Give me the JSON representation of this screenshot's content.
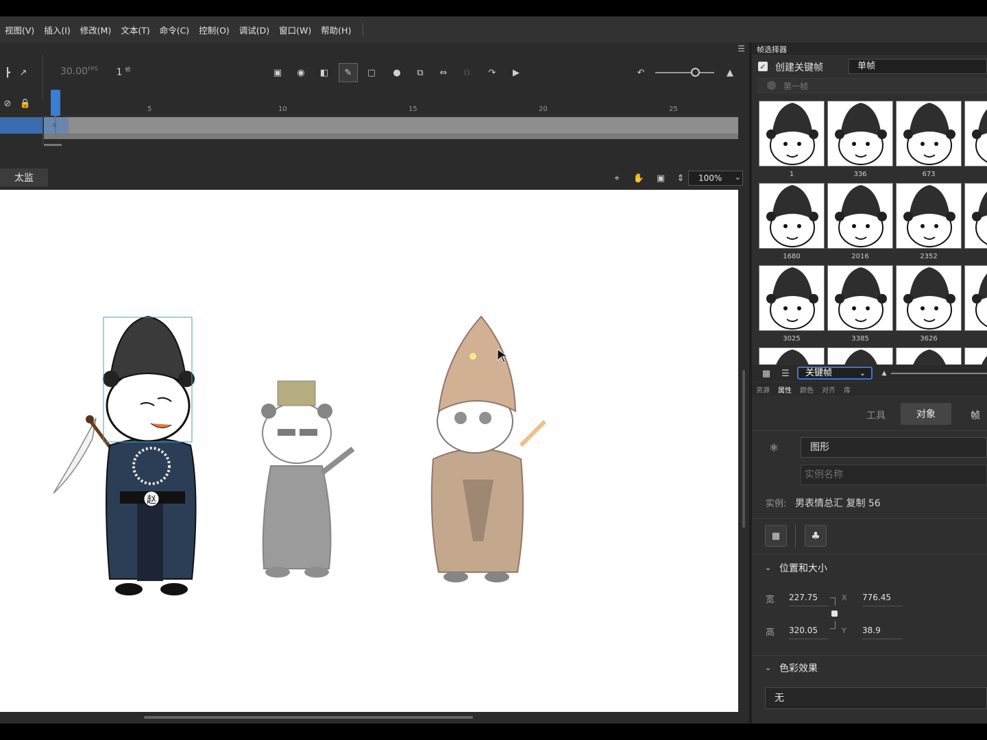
{
  "menu": {
    "items": [
      "视图(V)",
      "插入(I)",
      "修改(M)",
      "文本(T)",
      "命令(C)",
      "控制(O)",
      "调试(D)",
      "窗口(W)",
      "帮助(H)"
    ]
  },
  "timeline": {
    "fps": "30.00",
    "fps_unit": "FPS",
    "frame": "1",
    "frame_unit": "帧",
    "ruler_ticks": [
      "5",
      "10",
      "15",
      "20",
      "25"
    ],
    "keyframe_marker": "o"
  },
  "scene": {
    "tab_label": "太监",
    "zoom": "100%"
  },
  "stage": {
    "badge_char": "赵"
  },
  "frame_picker": {
    "title": "帧选择器",
    "create_keyframe_label": "创建关键帧",
    "create_keyframe_checked": true,
    "mode_select": "单帧",
    "first_frame_label": "第一帧",
    "thumbnails": [
      {
        "label": "1"
      },
      {
        "label": "336"
      },
      {
        "label": "673"
      },
      {
        "label": "1680"
      },
      {
        "label": "2016"
      },
      {
        "label": "2352"
      },
      {
        "label": "3025"
      },
      {
        "label": "3385"
      },
      {
        "label": "3626"
      }
    ],
    "footer_select": "关键帧"
  },
  "properties": {
    "tabs": [
      "资源",
      "属性",
      "颜色",
      "对齐",
      "库"
    ],
    "active_tab": "属性",
    "segments": {
      "tools": "工具",
      "object": "对象",
      "frame": "帧"
    },
    "symbol_type": "图形",
    "instance_name_placeholder": "实例名称",
    "instance_label": "实例:",
    "instance_value": "男表情总汇 复制 56",
    "position_size": {
      "title": "位置和大小",
      "width_label": "宽",
      "width": "227.75",
      "height_label": "高",
      "height": "320.05",
      "x_label": "X",
      "x": "776.45",
      "y_label": "Y",
      "y": "38.9"
    },
    "color_effect": {
      "title": "色彩效果",
      "value": "无"
    }
  },
  "colors": {
    "accent": "#3b7cd4",
    "panel_bg": "#2f2f2f",
    "stage_bg": "#ffffff"
  }
}
